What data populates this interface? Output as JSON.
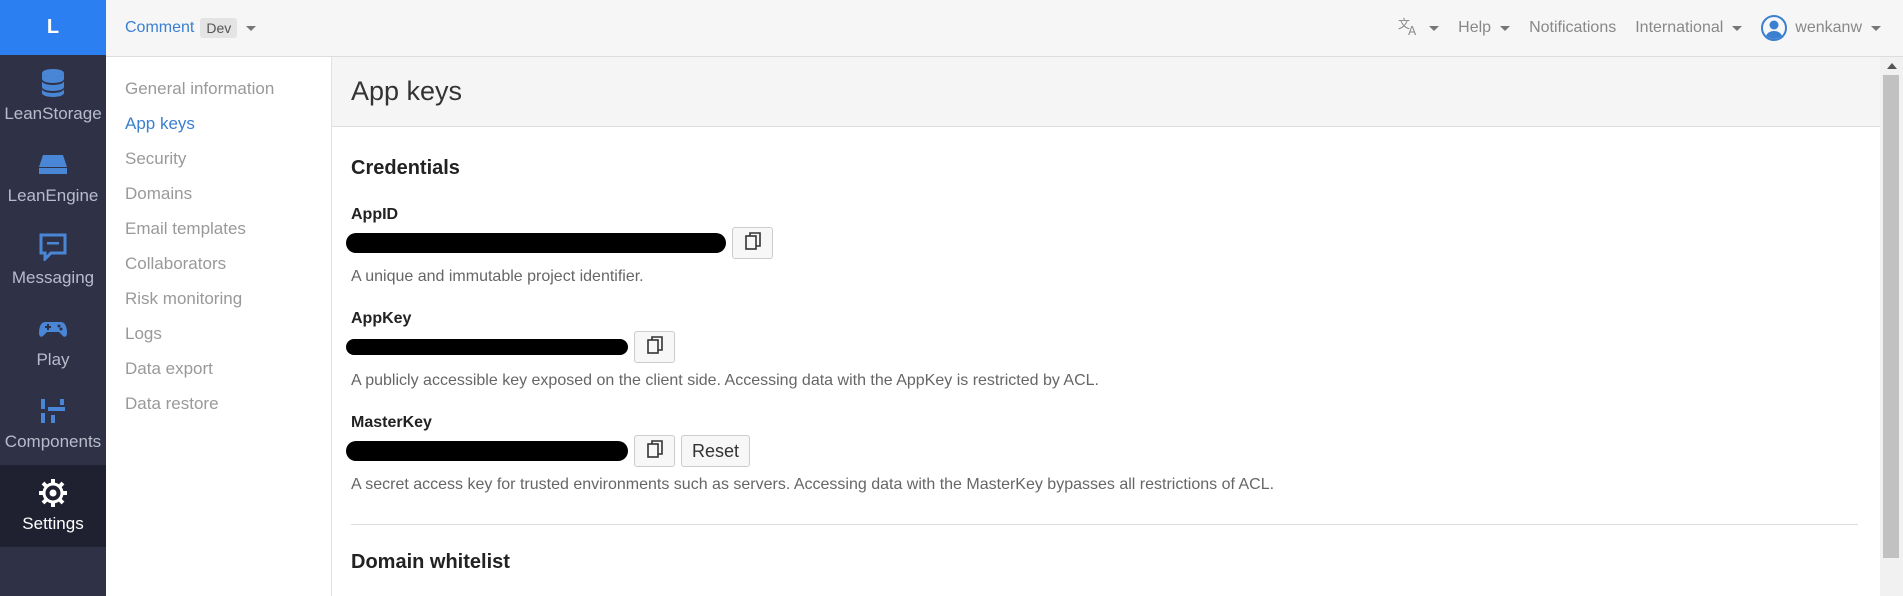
{
  "rail": {
    "logo": "L",
    "items": [
      {
        "label": "LeanStorage",
        "icon": "database-icon"
      },
      {
        "label": "LeanEngine",
        "icon": "engine-icon"
      },
      {
        "label": "Messaging",
        "icon": "chat-icon"
      },
      {
        "label": "Play",
        "icon": "gamepad-icon"
      },
      {
        "label": "Components",
        "icon": "components-icon"
      },
      {
        "label": "Settings",
        "icon": "gear-icon"
      }
    ]
  },
  "topbar": {
    "app_name": "Comment",
    "env": "Dev",
    "help": "Help",
    "notifications": "Notifications",
    "region": "International",
    "user": "wenkanw"
  },
  "subnav": {
    "items": [
      "General information",
      "App keys",
      "Security",
      "Domains",
      "Email templates",
      "Collaborators",
      "Risk monitoring",
      "Logs",
      "Data export",
      "Data restore"
    ],
    "active": "App keys"
  },
  "page": {
    "title": "App keys",
    "credentials_title": "Credentials",
    "appid": {
      "label": "AppID",
      "help": "A unique and immutable project identifier."
    },
    "appkey": {
      "label": "AppKey",
      "help": "A publicly accessible key exposed on the client side. Accessing data with the AppKey is restricted by ACL."
    },
    "masterkey": {
      "label": "MasterKey",
      "reset": "Reset",
      "help": "A secret access key for trusted environments such as servers. Accessing data with the MasterKey bypasses all restrictions of ACL."
    },
    "whitelist_title": "Domain whitelist"
  },
  "colors": {
    "accent": "#2c7ff0",
    "rail_bg": "#2f3247",
    "link": "#3a7fd0"
  }
}
